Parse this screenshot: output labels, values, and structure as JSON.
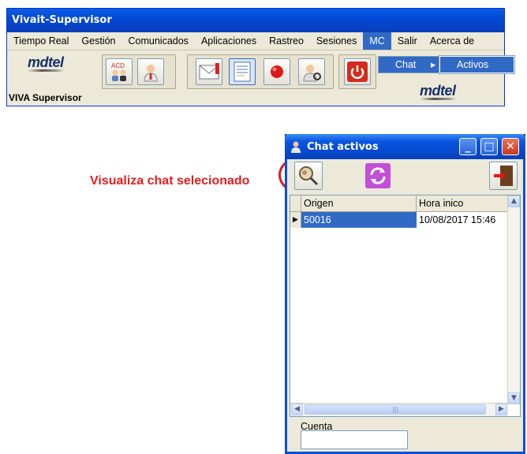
{
  "main_window": {
    "title": "Vivait-Supervisor",
    "menu": [
      "Tiempo Real",
      "Gestión",
      "Comunicados",
      "Aplicaciones",
      "Rastreo",
      "Sesiones",
      "MC",
      "Salir",
      "Acerca de"
    ],
    "active_menu": "MC",
    "submenu_item": "Chat",
    "submenu_arrow": "▸",
    "submenu_child": "Activos",
    "logo_text": "mdtel",
    "viva_label": "VIVA Supervisor",
    "acd_label": "ACD",
    "icons": {
      "acd": "acd-agents-icon",
      "agent": "agent-icon",
      "message": "message-envelope-icon",
      "report": "report-icon",
      "record": "record-icon",
      "monitor": "monitor-agent-icon",
      "power": "power-icon"
    }
  },
  "annotation": {
    "text": "Visualiza chat selecionado"
  },
  "chat_dialog": {
    "title": "Chat activos",
    "window_buttons": {
      "minimize": "_",
      "maximize": "□",
      "close": "✕"
    },
    "toolbar_icons": [
      "view-chat-icon",
      "refresh-icon",
      "exit-door-icon"
    ],
    "columns": [
      "Origen",
      "Hora inico"
    ],
    "rows": [
      {
        "origen": "50016",
        "hora_inico": "10/08/2017 15:46"
      }
    ],
    "row_indicator": "▶",
    "scroll": {
      "up": "▲",
      "down": "▼",
      "left": "◀",
      "right": "▶",
      "thumb_grip": "|||"
    },
    "cuenta_label": "Cuenta",
    "cuenta_value": ""
  },
  "colors": {
    "titlebar_blue": "#0347d8",
    "selection_blue": "#316ac5",
    "annotation_red": "#e02020",
    "window_face": "#ece9d8"
  }
}
